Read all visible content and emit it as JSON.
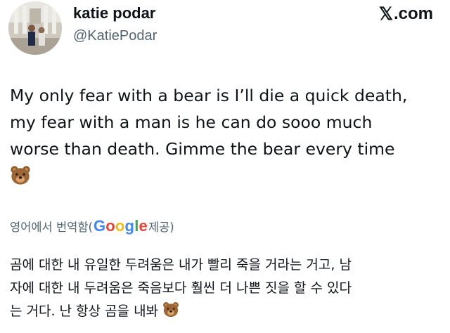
{
  "author": {
    "display_name": "katie podar",
    "handle": "@KatiePodar"
  },
  "brand": {
    "x_glyph": "𝕏",
    "suffix": ".com"
  },
  "tweet": {
    "lines": [
      "My only fear with a bear is I’ll die a quick death,",
      "my fear with a man is he can do sooo much",
      "worse than death. Gimme the bear every time"
    ],
    "emoji": "bear-face"
  },
  "translation": {
    "label_before": "영어에서 번역함(",
    "provider_letters": [
      "G",
      "o",
      "o",
      "g",
      "l",
      "e"
    ],
    "label_after": " 제공)",
    "lines": [
      "곰에 대한 내 유일한 두려움은 내가 빨리 죽을 거라는 거고, 남",
      "자에 대한 내 두려움은 죽음보다 훨씬 더 나쁜 짓을 할 수 있다",
      "는 거다. 난 항상 곰을 내봐"
    ],
    "emoji": "bear-face"
  },
  "colors": {
    "text_primary": "#0f1419",
    "text_secondary": "#536471",
    "google_blue": "#4285F4",
    "google_red": "#EA4335",
    "google_yellow": "#FBBC05",
    "google_green": "#34A853"
  }
}
